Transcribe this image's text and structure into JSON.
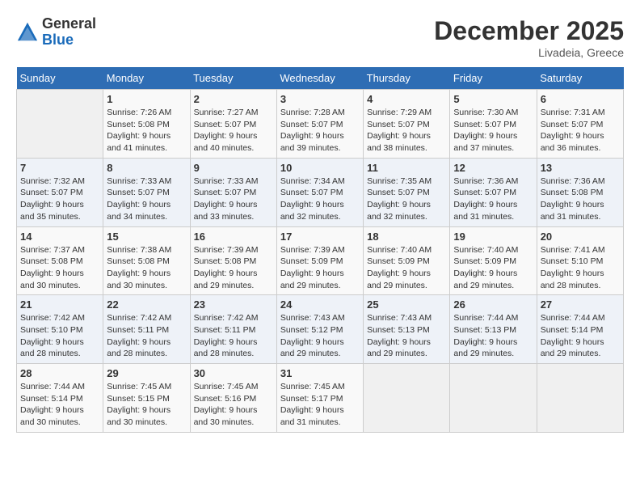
{
  "header": {
    "logo_line1": "General",
    "logo_line2": "Blue",
    "month": "December 2025",
    "location": "Livadeia, Greece"
  },
  "weekdays": [
    "Sunday",
    "Monday",
    "Tuesday",
    "Wednesday",
    "Thursday",
    "Friday",
    "Saturday"
  ],
  "weeks": [
    [
      {
        "day": "",
        "empty": true
      },
      {
        "day": "1",
        "rise": "7:26 AM",
        "set": "5:08 PM",
        "daylight": "9 hours and 41 minutes."
      },
      {
        "day": "2",
        "rise": "7:27 AM",
        "set": "5:07 PM",
        "daylight": "9 hours and 40 minutes."
      },
      {
        "day": "3",
        "rise": "7:28 AM",
        "set": "5:07 PM",
        "daylight": "9 hours and 39 minutes."
      },
      {
        "day": "4",
        "rise": "7:29 AM",
        "set": "5:07 PM",
        "daylight": "9 hours and 38 minutes."
      },
      {
        "day": "5",
        "rise": "7:30 AM",
        "set": "5:07 PM",
        "daylight": "9 hours and 37 minutes."
      },
      {
        "day": "6",
        "rise": "7:31 AM",
        "set": "5:07 PM",
        "daylight": "9 hours and 36 minutes."
      }
    ],
    [
      {
        "day": "7",
        "rise": "7:32 AM",
        "set": "5:07 PM",
        "daylight": "9 hours and 35 minutes."
      },
      {
        "day": "8",
        "rise": "7:33 AM",
        "set": "5:07 PM",
        "daylight": "9 hours and 34 minutes."
      },
      {
        "day": "9",
        "rise": "7:33 AM",
        "set": "5:07 PM",
        "daylight": "9 hours and 33 minutes."
      },
      {
        "day": "10",
        "rise": "7:34 AM",
        "set": "5:07 PM",
        "daylight": "9 hours and 32 minutes."
      },
      {
        "day": "11",
        "rise": "7:35 AM",
        "set": "5:07 PM",
        "daylight": "9 hours and 32 minutes."
      },
      {
        "day": "12",
        "rise": "7:36 AM",
        "set": "5:07 PM",
        "daylight": "9 hours and 31 minutes."
      },
      {
        "day": "13",
        "rise": "7:36 AM",
        "set": "5:08 PM",
        "daylight": "9 hours and 31 minutes."
      }
    ],
    [
      {
        "day": "14",
        "rise": "7:37 AM",
        "set": "5:08 PM",
        "daylight": "9 hours and 30 minutes."
      },
      {
        "day": "15",
        "rise": "7:38 AM",
        "set": "5:08 PM",
        "daylight": "9 hours and 30 minutes."
      },
      {
        "day": "16",
        "rise": "7:39 AM",
        "set": "5:08 PM",
        "daylight": "9 hours and 29 minutes."
      },
      {
        "day": "17",
        "rise": "7:39 AM",
        "set": "5:09 PM",
        "daylight": "9 hours and 29 minutes."
      },
      {
        "day": "18",
        "rise": "7:40 AM",
        "set": "5:09 PM",
        "daylight": "9 hours and 29 minutes."
      },
      {
        "day": "19",
        "rise": "7:40 AM",
        "set": "5:09 PM",
        "daylight": "9 hours and 29 minutes."
      },
      {
        "day": "20",
        "rise": "7:41 AM",
        "set": "5:10 PM",
        "daylight": "9 hours and 28 minutes."
      }
    ],
    [
      {
        "day": "21",
        "rise": "7:42 AM",
        "set": "5:10 PM",
        "daylight": "9 hours and 28 minutes."
      },
      {
        "day": "22",
        "rise": "7:42 AM",
        "set": "5:11 PM",
        "daylight": "9 hours and 28 minutes."
      },
      {
        "day": "23",
        "rise": "7:42 AM",
        "set": "5:11 PM",
        "daylight": "9 hours and 28 minutes."
      },
      {
        "day": "24",
        "rise": "7:43 AM",
        "set": "5:12 PM",
        "daylight": "9 hours and 29 minutes."
      },
      {
        "day": "25",
        "rise": "7:43 AM",
        "set": "5:13 PM",
        "daylight": "9 hours and 29 minutes."
      },
      {
        "day": "26",
        "rise": "7:44 AM",
        "set": "5:13 PM",
        "daylight": "9 hours and 29 minutes."
      },
      {
        "day": "27",
        "rise": "7:44 AM",
        "set": "5:14 PM",
        "daylight": "9 hours and 29 minutes."
      }
    ],
    [
      {
        "day": "28",
        "rise": "7:44 AM",
        "set": "5:14 PM",
        "daylight": "9 hours and 30 minutes."
      },
      {
        "day": "29",
        "rise": "7:45 AM",
        "set": "5:15 PM",
        "daylight": "9 hours and 30 minutes."
      },
      {
        "day": "30",
        "rise": "7:45 AM",
        "set": "5:16 PM",
        "daylight": "9 hours and 30 minutes."
      },
      {
        "day": "31",
        "rise": "7:45 AM",
        "set": "5:17 PM",
        "daylight": "9 hours and 31 minutes."
      },
      {
        "day": "",
        "empty": true
      },
      {
        "day": "",
        "empty": true
      },
      {
        "day": "",
        "empty": true
      }
    ]
  ]
}
